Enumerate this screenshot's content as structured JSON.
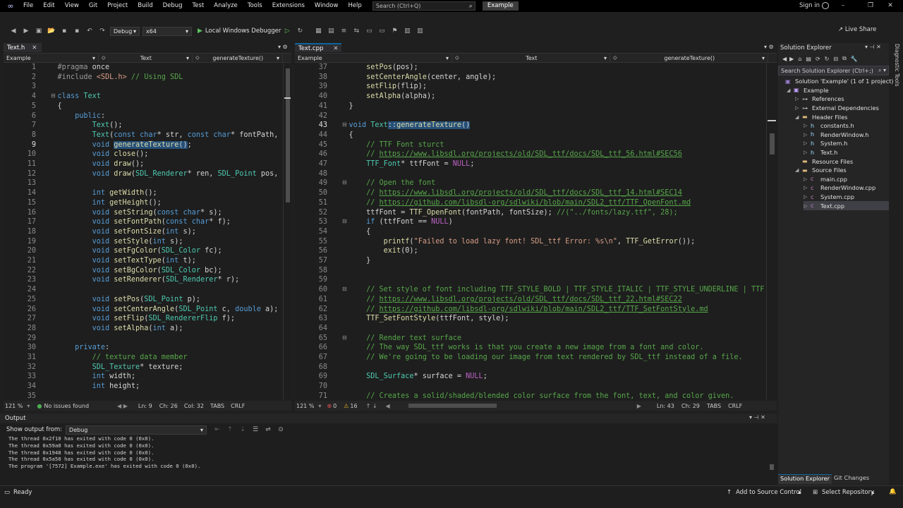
{
  "app": {
    "menu": [
      "File",
      "Edit",
      "View",
      "Git",
      "Project",
      "Build",
      "Debug",
      "Test",
      "Analyze",
      "Tools",
      "Extensions",
      "Window",
      "Help"
    ],
    "search_placeholder": "Search (Ctrl+Q)",
    "solution_name": "Example",
    "sign_in": "Sign in",
    "live_share": "Live Share"
  },
  "toolbar": {
    "config": "Debug",
    "platform": "x64",
    "run_label": "Local Windows Debugger"
  },
  "left_editor": {
    "tab": "Text.h",
    "nav": [
      "Example",
      "Text",
      "generateTexture()"
    ],
    "lines": [
      {
        "n": "1",
        "t": "    #pragma once"
      },
      {
        "n": "2",
        "t": "    #include <SDL.h> // Using SDL"
      },
      {
        "n": "3",
        "t": ""
      },
      {
        "n": "4",
        "t": "    class Text"
      },
      {
        "n": "5",
        "t": "    {"
      },
      {
        "n": "6",
        "t": "        public:"
      },
      {
        "n": "7",
        "t": "            Text();"
      },
      {
        "n": "8",
        "t": "            Text(const char* str, const char* fontPath,"
      },
      {
        "n": "9",
        "t": "            void generateTexture();"
      },
      {
        "n": "10",
        "t": "            void close();"
      },
      {
        "n": "11",
        "t": "            void draw();"
      },
      {
        "n": "12",
        "t": "            void draw(SDL_Renderer* ren, SDL_Point pos,"
      },
      {
        "n": "13",
        "t": ""
      },
      {
        "n": "14",
        "t": "            int getWidth();"
      },
      {
        "n": "15",
        "t": "            int getHeight();"
      },
      {
        "n": "16",
        "t": "            void setString(const char* s);"
      },
      {
        "n": "17",
        "t": "            void setFontPath(const char* f);"
      },
      {
        "n": "18",
        "t": "            void setFontSize(int s);"
      },
      {
        "n": "19",
        "t": "            void setStyle(int s);"
      },
      {
        "n": "20",
        "t": "            void setFgColor(SDL_Color fc);"
      },
      {
        "n": "21",
        "t": "            void setTextType(int t);"
      },
      {
        "n": "22",
        "t": "            void setBgColor(SDL_Color bc);"
      },
      {
        "n": "23",
        "t": "            void setRenderer(SDL_Renderer* r);"
      },
      {
        "n": "24",
        "t": ""
      },
      {
        "n": "25",
        "t": "            void setPos(SDL_Point p);"
      },
      {
        "n": "26",
        "t": "            void setCenterAngle(SDL_Point c, double a);"
      },
      {
        "n": "27",
        "t": "            void setFlip(SDL_RendererFlip f);"
      },
      {
        "n": "28",
        "t": "            void setAlpha(int a);"
      },
      {
        "n": "29",
        "t": ""
      },
      {
        "n": "30",
        "t": "        private:"
      },
      {
        "n": "31",
        "t": "            // texture data member"
      },
      {
        "n": "32",
        "t": "            SDL_Texture* texture;"
      },
      {
        "n": "33",
        "t": "            int width;"
      },
      {
        "n": "34",
        "t": "            int height;"
      },
      {
        "n": "35",
        "t": ""
      }
    ],
    "status": {
      "zoom": "121 %",
      "issues": "No issues found",
      "ln": "Ln: 9",
      "ch": "Ch: 26",
      "col": "Col: 32",
      "tabs": "TABS",
      "crlf": "CRLF"
    }
  },
  "right_editor": {
    "tab": "Text.cpp",
    "nav": [
      "Example",
      "Text",
      "generateTexture()"
    ],
    "lines": [
      {
        "n": "37",
        "t": "        setPos(pos);"
      },
      {
        "n": "38",
        "t": "        setCenterAngle(center, angle);"
      },
      {
        "n": "39",
        "t": "        setFlip(flip);"
      },
      {
        "n": "40",
        "t": "        setAlpha(alpha);"
      },
      {
        "n": "41",
        "t": "    }"
      },
      {
        "n": "42",
        "t": ""
      },
      {
        "n": "43",
        "t": "    void Text::generateTexture()"
      },
      {
        "n": "44",
        "t": "    {"
      },
      {
        "n": "45",
        "t": "        // TTF Font sturct"
      },
      {
        "n": "46",
        "t": "        // https://www.libsdl.org/projects/old/SDL_ttf/docs/SDL_ttf_56.html#SEC56"
      },
      {
        "n": "47",
        "t": "        TTF_Font* ttfFont = NULL;"
      },
      {
        "n": "48",
        "t": ""
      },
      {
        "n": "49",
        "t": "        // Open the font"
      },
      {
        "n": "50",
        "t": "        // https://www.libsdl.org/projects/old/SDL_ttf/docs/SDL_ttf_14.html#SEC14"
      },
      {
        "n": "51",
        "t": "        // https://github.com/libsdl-org/sdlwiki/blob/main/SDL2_ttf/TTF_OpenFont.md"
      },
      {
        "n": "52",
        "t": "        ttfFont = TTF_OpenFont(fontPath, fontSize); //(\"../fonts/lazy.ttf\", 28);"
      },
      {
        "n": "53",
        "t": "        if (ttfFont == NULL)"
      },
      {
        "n": "54",
        "t": "        {"
      },
      {
        "n": "55",
        "t": "            printf(\"Failed to load lazy font! SDL_ttf Error: %s\\n\", TTF_GetError());"
      },
      {
        "n": "56",
        "t": "            exit(0);"
      },
      {
        "n": "57",
        "t": "        }"
      },
      {
        "n": "58",
        "t": ""
      },
      {
        "n": "59",
        "t": ""
      },
      {
        "n": "60",
        "t": "        // Set style of font including TTF_STYLE_BOLD | TTF_STYLE_ITALIC | TTF_STYLE_UNDERLINE | TTF"
      },
      {
        "n": "61",
        "t": "        // https://www.libsdl.org/projects/old/SDL_ttf/docs/SDL_ttf_22.html#SEC22"
      },
      {
        "n": "62",
        "t": "        // https://github.com/libsdl-org/sdlwiki/blob/main/SDL2_ttf/TTF_SetFontStyle.md"
      },
      {
        "n": "63",
        "t": "        TTF_SetFontStyle(ttfFont, style);"
      },
      {
        "n": "64",
        "t": ""
      },
      {
        "n": "65",
        "t": "        // Render text surface"
      },
      {
        "n": "66",
        "t": "        // The way SDL_ttf works is that you create a new image from a font and color."
      },
      {
        "n": "67",
        "t": "        // We're going to be loading our image from text rendered by SDL_ttf instead of a file."
      },
      {
        "n": "68",
        "t": ""
      },
      {
        "n": "69",
        "t": "        SDL_Surface* surface = NULL;"
      },
      {
        "n": "70",
        "t": ""
      },
      {
        "n": "71",
        "t": "        // Creates a solid/shaded/blended color surface from the font, text, and color given."
      }
    ],
    "status": {
      "zoom": "121 %",
      "errors": "0",
      "warnings": "16",
      "ln": "Ln: 43",
      "ch": "Ch: 29",
      "tabs": "TABS",
      "crlf": "CRLF"
    }
  },
  "solution_explorer": {
    "title": "Solution Explorer",
    "search_placeholder": "Search Solution Explorer (Ctrl+;)",
    "items": [
      {
        "label": "Solution 'Example' (1 of 1 project)",
        "depth": 0,
        "arrow": "",
        "icon": "solution-icon"
      },
      {
        "label": "Example",
        "depth": 1,
        "arrow": "◢",
        "icon": "project-icon"
      },
      {
        "label": "References",
        "depth": 2,
        "arrow": "▷",
        "icon": "references-icon"
      },
      {
        "label": "External Dependencies",
        "depth": 2,
        "arrow": "▷",
        "icon": "dependencies-icon"
      },
      {
        "label": "Header Files",
        "depth": 2,
        "arrow": "◢",
        "icon": "folder-icon"
      },
      {
        "label": "constants.h",
        "depth": 3,
        "arrow": "▷",
        "icon": "header-file-icon"
      },
      {
        "label": "RenderWindow.h",
        "depth": 3,
        "arrow": "▷",
        "icon": "header-file-icon"
      },
      {
        "label": "System.h",
        "depth": 3,
        "arrow": "▷",
        "icon": "header-file-icon"
      },
      {
        "label": "Text.h",
        "depth": 3,
        "arrow": "▷",
        "icon": "header-file-icon"
      },
      {
        "label": "Resource Files",
        "depth": 2,
        "arrow": "",
        "icon": "folder-icon"
      },
      {
        "label": "Source Files",
        "depth": 2,
        "arrow": "◢",
        "icon": "folder-icon"
      },
      {
        "label": "main.cpp",
        "depth": 3,
        "arrow": "▷",
        "icon": "cpp-file-icon"
      },
      {
        "label": "RenderWindow.cpp",
        "depth": 3,
        "arrow": "▷",
        "icon": "cpp-file-icon"
      },
      {
        "label": "System.cpp",
        "depth": 3,
        "arrow": "▷",
        "icon": "cpp-file-icon"
      },
      {
        "label": "Text.cpp",
        "depth": 3,
        "arrow": "▷",
        "icon": "cpp-file-icon"
      }
    ],
    "tabs": [
      "Solution Explorer",
      "Git Changes"
    ],
    "side_label": "Diagnostic Tools"
  },
  "output": {
    "title": "Output",
    "show_from_label": "Show output from:",
    "source": "Debug",
    "lines": [
      "The thread 0x2f10 has exited with code 0 (0x0).",
      "The thread 0x59a0 has exited with code 0 (0x0).",
      "The thread 0x1948 has exited with code 0 (0x0).",
      "The thread 0x5a50 has exited with code 0 (0x0).",
      "The program '[7572] Example.exe' has exited with code 0 (0x0)."
    ]
  },
  "statusbar": {
    "ready": "Ready",
    "source_control": "Add to Source Control",
    "repository": "Select Repository"
  },
  "colors": {
    "accent": "#0e639c",
    "background": "#1e1e1e",
    "keyword": "#569cd6",
    "comment": "#57a64a"
  }
}
